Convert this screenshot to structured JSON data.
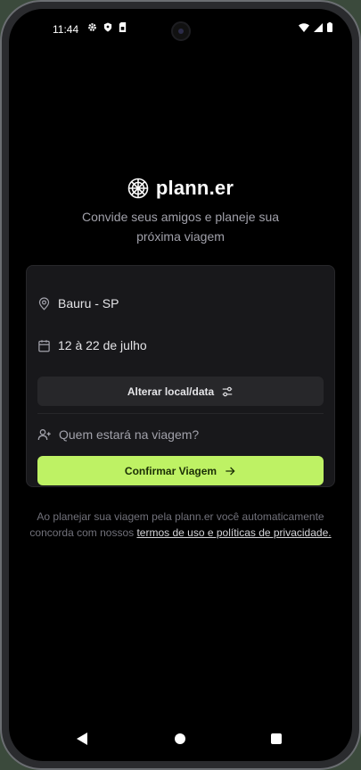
{
  "status_bar": {
    "time": "11:44"
  },
  "brand": {
    "name": "plann.er"
  },
  "tagline": {
    "line1": "Convide seus amigos e planeje sua",
    "line2": "próxima viagem"
  },
  "trip": {
    "location": "Bauru - SP",
    "dates": "12 à 22 de julho",
    "change_button_label": "Alterar local/data",
    "guests_placeholder": "Quem estará na viagem?",
    "confirm_button_label": "Confirmar Viagem"
  },
  "legal": {
    "text": "Ao planejar sua viagem pela plann.er você automaticamente concorda com nossos ",
    "link": "termos de uso e políticas de privacidade."
  },
  "colors": {
    "accent": "#bef264",
    "background": "#000000",
    "card": "#18181b",
    "secondary_button": "#27272a"
  }
}
